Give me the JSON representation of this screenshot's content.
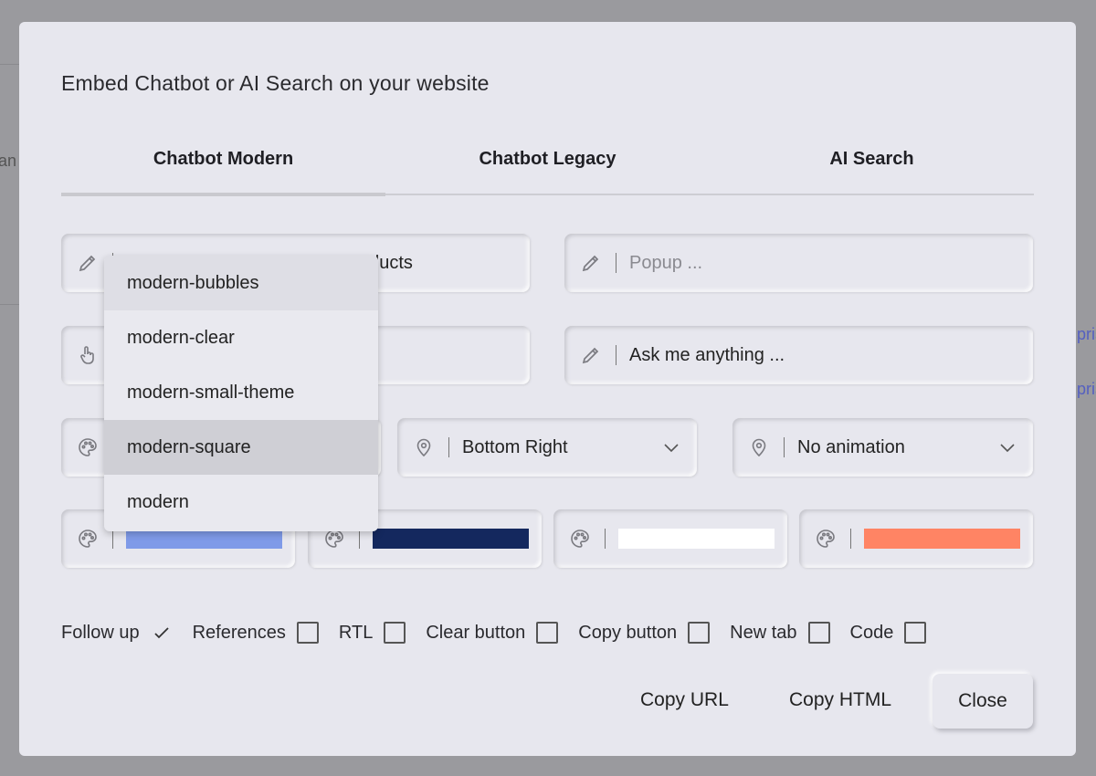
{
  "background": {
    "frag_left": "an",
    "frag_right_1": "pris",
    "frag_right_2": "pris"
  },
  "modal": {
    "title": "Embed Chatbot or AI Search on your website"
  },
  "tabs": [
    {
      "label": "Chatbot Modern",
      "active": true
    },
    {
      "label": "Chatbot Legacy",
      "active": false
    },
    {
      "label": "AI Search",
      "active": false
    }
  ],
  "fields": {
    "name_visible_suffix": "oducts",
    "popup_placeholder": "Popup ...",
    "greeting_value": "Ask me anything ...",
    "position_value": "Bottom Right",
    "animation_value": "No animation"
  },
  "theme_dropdown": {
    "options": [
      "modern-bubbles",
      "modern-clear",
      "modern-small-theme",
      "modern-square",
      "modern"
    ],
    "hovered": "modern-bubbles",
    "selected": "modern-square"
  },
  "colors": {
    "primary": "#7f9ae8",
    "secondary": "#14285e",
    "background": "#ffffff",
    "accent": "#ff8464"
  },
  "checkboxes": [
    {
      "label": "Follow up",
      "checked": true
    },
    {
      "label": "References",
      "checked": false
    },
    {
      "label": "RTL",
      "checked": false
    },
    {
      "label": "Clear button",
      "checked": false
    },
    {
      "label": "Copy button",
      "checked": false
    },
    {
      "label": "New tab",
      "checked": false
    },
    {
      "label": "Code",
      "checked": false
    }
  ],
  "actions": {
    "copy_url": "Copy URL",
    "copy_html": "Copy HTML",
    "close": "Close"
  }
}
